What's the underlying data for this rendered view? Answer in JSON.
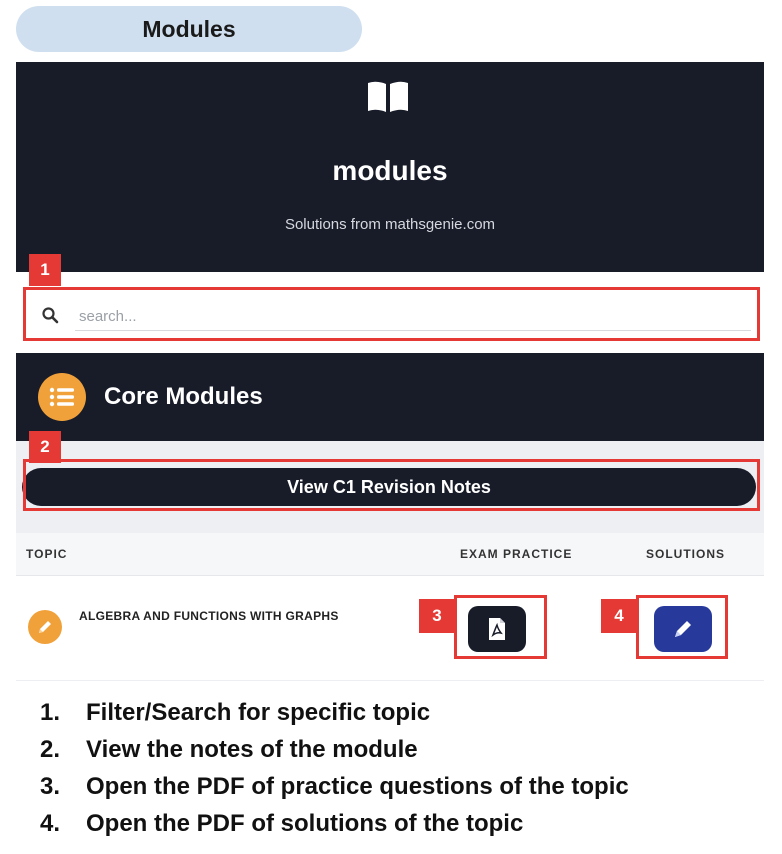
{
  "header": {
    "section_label": "Modules"
  },
  "hero": {
    "icon": "book-icon",
    "title": "modules",
    "subtitle": "Solutions from mathsgenie.com"
  },
  "search": {
    "placeholder": "search...",
    "value": "",
    "icon": "search-icon"
  },
  "core": {
    "icon": "list-icon",
    "title": "Core Modules"
  },
  "notes_button": {
    "label": "View C1 Revision Notes"
  },
  "table": {
    "columns": [
      "TOPIC",
      "EXAM PRACTICE",
      "SOLUTIONS"
    ],
    "rows": [
      {
        "icon": "pencil-icon",
        "topic": "ALGEBRA AND FUNCTIONS WITH GRAPHS",
        "exam_practice_icon": "pdf-icon",
        "solutions_icon": "pen-icon"
      }
    ]
  },
  "callouts": [
    "1",
    "2",
    "3",
    "4"
  ],
  "legend": [
    {
      "num": "1.",
      "text": "Filter/Search for specific topic"
    },
    {
      "num": "2.",
      "text": "View the notes of the module"
    },
    {
      "num": "3.",
      "text": "Open the PDF of practice questions of the topic"
    },
    {
      "num": "4.",
      "text": "Open the PDF of solutions of the topic"
    }
  ],
  "colors": {
    "dark": "#181c29",
    "accent_orange": "#f0a13a",
    "solutions_blue": "#273a9b",
    "callout_red": "#e53935",
    "pill_blue": "#cfdff0"
  }
}
